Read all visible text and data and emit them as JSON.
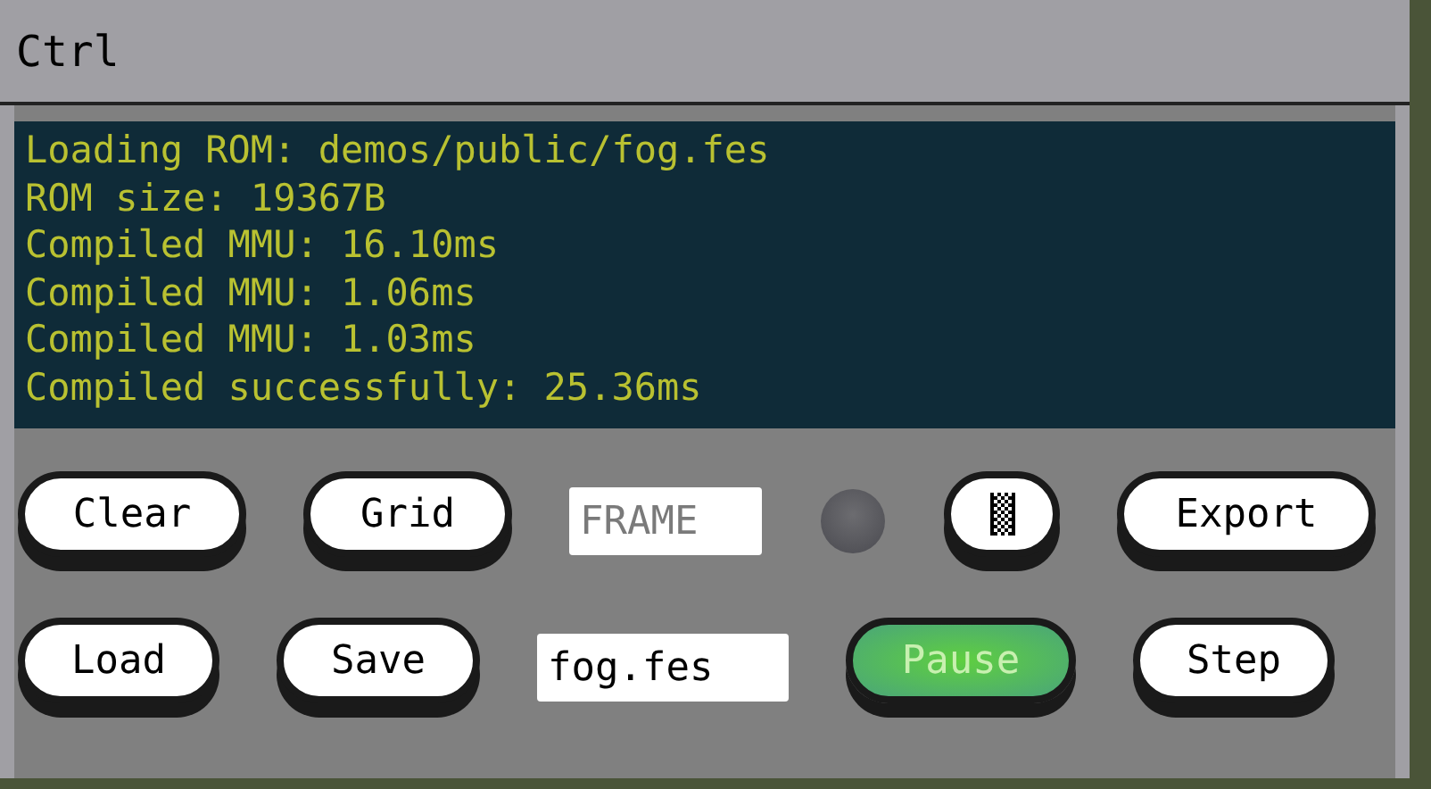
{
  "window": {
    "title": "Ctrl"
  },
  "log": [
    "Loading ROM: demos/public/fog.fes",
    "ROM size: 19367B",
    "Compiled MMU: 16.10ms",
    "Compiled MMU: 1.06ms",
    "Compiled MMU: 1.03ms",
    "Compiled successfully: 25.36ms"
  ],
  "rows": [
    [
      {
        "kind": "button",
        "label": "Clear",
        "on": false
      },
      {
        "kind": "button",
        "label": "Grid",
        "on": false
      },
      {
        "kind": "field",
        "placeholder": "FRAME"
      },
      {
        "kind": "led",
        "on": false
      },
      {
        "kind": "icon-button",
        "on": false
      },
      {
        "kind": "button",
        "label": "Export",
        "on": false
      }
    ],
    [
      {
        "kind": "button",
        "label": "Load",
        "on": false
      },
      {
        "kind": "button",
        "label": "Save",
        "on": false
      },
      {
        "kind": "field",
        "value": "fog.fes"
      },
      {
        "kind": "button",
        "label": "Pause",
        "on": true
      },
      {
        "kind": "button",
        "label": "Step",
        "on": false
      }
    ]
  ]
}
